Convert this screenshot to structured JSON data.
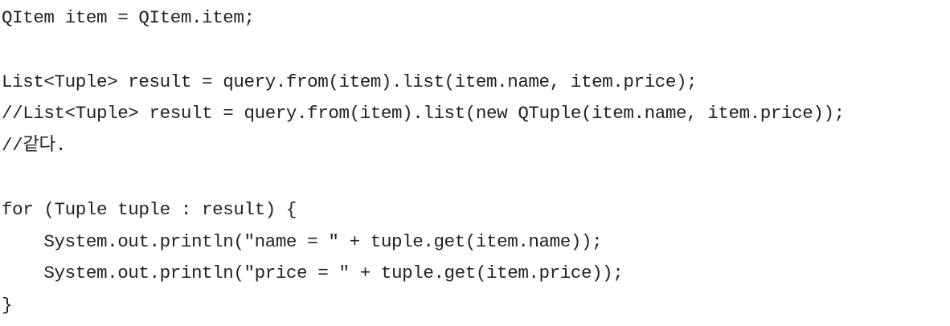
{
  "code": {
    "lines": [
      "QItem item = QItem.item;",
      "List<Tuple> result = query.from(item).list(item.name, item.price);",
      "//List<Tuple> result = query.from(item).list(new QTuple(item.name, item.price));",
      "//같다.",
      "for (Tuple tuple : result) {",
      "    System.out.println(\"name = \" + tuple.get(item.name));",
      "    System.out.println(\"price = \" + tuple.get(item.price));",
      "}"
    ]
  }
}
